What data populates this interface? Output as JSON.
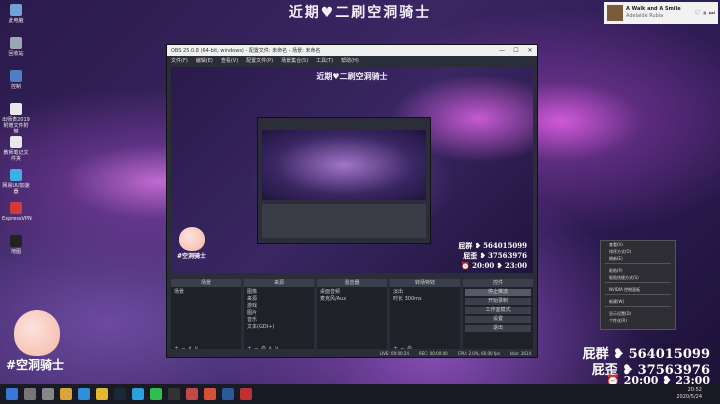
{
  "banner": "近期♥二刷空洞骑士",
  "desktop_icons": [
    {
      "label": "此电脑",
      "color": "#6fa3d8"
    },
    {
      "label": "回收站",
      "color": "#9aa7b5"
    },
    {
      "label": "控制",
      "color": "#4f7ec2"
    },
    {
      "label": "出师表2019附赠文件附带",
      "color": "#e8e8e8"
    },
    {
      "label": "教师笔记文件夹",
      "color": "#e8e8e8"
    },
    {
      "label": "网易UU加速器",
      "color": "#3fb0e6"
    },
    {
      "label": "ExpressVPN",
      "color": "#d23a3a"
    },
    {
      "label": "地图",
      "color": "#222222"
    }
  ],
  "notification": {
    "title": "A Walk and A Smile",
    "subtitle": "Adelaide Rubia",
    "controls": "♡ ⏸ ⏭"
  },
  "obs": {
    "title": "OBS 25.0.8 (64-bit, windows) - 配置文件: 未命名 - 场景: 未命名",
    "menu": [
      "文件(F)",
      "编辑(E)",
      "查看(V)",
      "配置文件(P)",
      "场景集合(S)",
      "工具(T)",
      "帮助(H)"
    ],
    "window_buttons": [
      "—",
      "☐",
      "✕"
    ],
    "preview_title": "近期♥二刷空洞骑士",
    "preview_stats": {
      "group": "屁群 ❥ 564015099",
      "wai": "屁歪 ❥ 37563976",
      "time": "⏰ 20:00 ❥ 23:00"
    },
    "preview_peach_label": "#空洞骑士",
    "panels": [
      {
        "title": "场景",
        "items": [
          "场景"
        ],
        "footer": "+ − ∧ ∨"
      },
      {
        "title": "来源",
        "items": [
          "图像",
          "来源",
          "游戏",
          "图片",
          "音乐",
          "文本(GDI+)"
        ],
        "footer": "+ − ⚙ ∧ ∨"
      },
      {
        "title": "混音器",
        "items": [
          "桌面音频",
          "麦克风/Aux"
        ],
        "footer": ""
      },
      {
        "title": "转场特效",
        "items": [
          "淡出",
          "时长 300ms"
        ],
        "footer": "+ − ⚙"
      },
      {
        "title": "控件",
        "items": [],
        "footer": ""
      }
    ],
    "controls": [
      "停止推流",
      "开始录制",
      "工作室模式",
      "设置",
      "退出"
    ],
    "status": [
      "LIVE: 00:00:24",
      "REC: 00:00:00",
      "CPU: 2.0%, 60.00 fps",
      "kb/s: 2614"
    ]
  },
  "context_menu": [
    "查看(V)",
    "排序方式(O)",
    "刷新(E)",
    "",
    "粘贴(P)",
    "粘贴快捷方式(S)",
    "",
    "NVIDIA 控制面板",
    "",
    "新建(W)",
    "",
    "显示设置(D)",
    "个性化(R)"
  ],
  "stats": {
    "group": "屁群 ❥ 564015099",
    "wai": "屁歪 ❥ 37563976",
    "time": "⏰ 20:00 ❥ 23:00"
  },
  "peach_label": "#空洞骑士",
  "taskbar": {
    "icons": [
      "start",
      "search",
      "taskview",
      "files",
      "edge",
      "chrome",
      "steam",
      "qq",
      "wechat",
      "obs",
      "game",
      "music",
      "ps",
      "pdf"
    ],
    "time": "20:52",
    "date": "2020/5/24"
  }
}
